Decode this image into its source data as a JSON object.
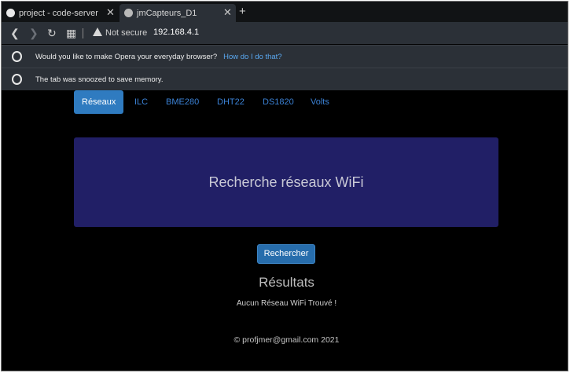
{
  "browser": {
    "tabs": [
      {
        "title": "project - code-server",
        "close": "✕"
      },
      {
        "title": "jmCapteurs_D1",
        "close": "✕"
      }
    ],
    "new_tab": "+",
    "nav": {
      "back": "❮",
      "forward": "❯",
      "reload": "↻",
      "grid": "▦"
    },
    "security_label": "Not secure",
    "url": "192.168.4.1"
  },
  "infobars": [
    {
      "text": "Would you like to make Opera your everyday browser?",
      "link": "How do I do that?"
    },
    {
      "text": "The tab was snoozed to save memory."
    }
  ],
  "page": {
    "nav_tabs": [
      "Réseaux",
      "ILC",
      "BME280",
      "DHT22",
      "DS1820",
      "Volts"
    ],
    "active_tab": "Réseaux",
    "banner_title": "Recherche réseaux WiFi",
    "search_button": "Rechercher",
    "results_title": "Résultats",
    "results_message": "Aucun Réseau WiFi Trouvé !",
    "footer": "© profjmer@gmail.com 2021"
  },
  "colors": {
    "tab_active": "#2f7bc0",
    "tab_link": "#3b82d6",
    "banner_bg": "#211f66",
    "button_bg": "#276dac",
    "link": "#5aa9f2"
  }
}
